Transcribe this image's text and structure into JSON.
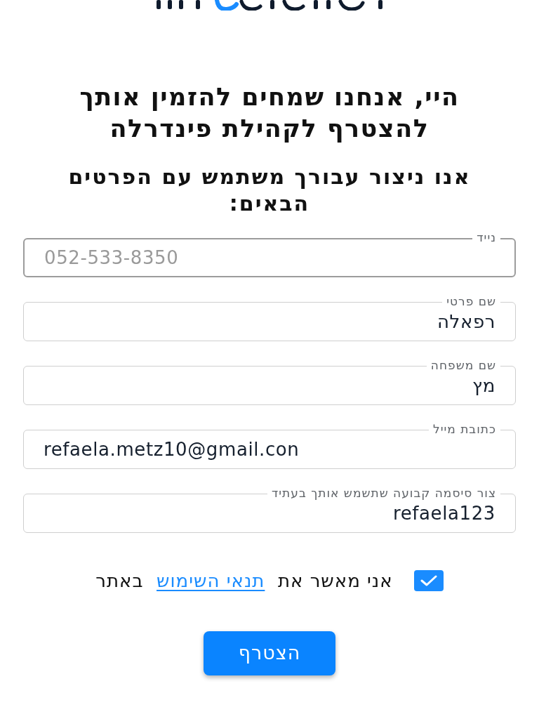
{
  "heading": "היי, אנחנו שמחים להזמין אותך להצטרף לקהילת פינדרלה",
  "subheading": "אנו ניצור עבורך משתמש עם הפרטים הבאים:",
  "fields": [
    {
      "kind": "tel",
      "label": "נייד",
      "placeholder": "052-533-8350",
      "focused": true
    },
    {
      "kind": "text",
      "label": "שם פרטי",
      "value": "רפאלה",
      "focused": false
    },
    {
      "kind": "text",
      "label": "שם משפחה",
      "value": "מץ",
      "focused": false
    },
    {
      "kind": "email",
      "label": "כתובת מייל",
      "value": "refaela.metz10@gmail.con",
      "focused": false
    },
    {
      "kind": "text",
      "label": "צור סיסמה קבועה שתשמש אותך בעתיד",
      "value": "refaela123",
      "focused": false
    }
  ],
  "consent": {
    "checked": true,
    "text_before": "אני מאשר את",
    "link": "תנאי השימוש",
    "text_after": "באתר"
  },
  "submit_button": "הצטרף"
}
